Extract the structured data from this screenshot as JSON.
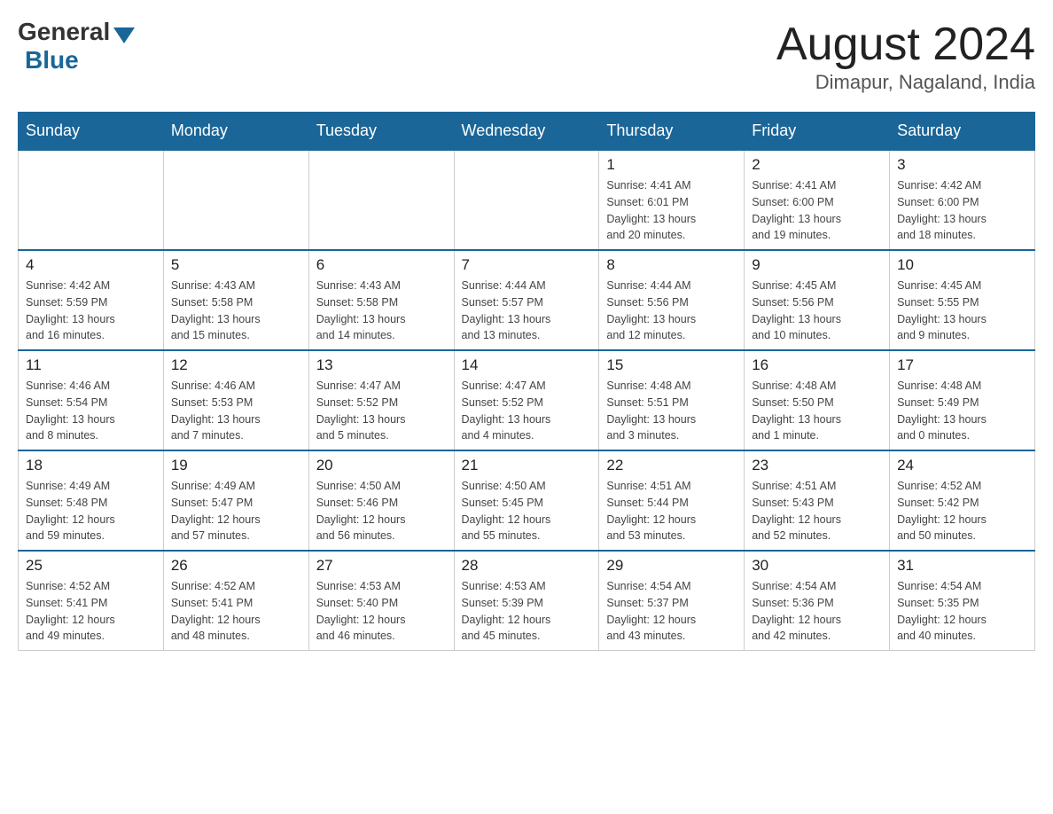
{
  "header": {
    "logo_general": "General",
    "logo_blue": "Blue",
    "month_title": "August 2024",
    "location": "Dimapur, Nagaland, India"
  },
  "weekdays": [
    "Sunday",
    "Monday",
    "Tuesday",
    "Wednesday",
    "Thursday",
    "Friday",
    "Saturday"
  ],
  "weeks": [
    [
      {
        "day": "",
        "info": ""
      },
      {
        "day": "",
        "info": ""
      },
      {
        "day": "",
        "info": ""
      },
      {
        "day": "",
        "info": ""
      },
      {
        "day": "1",
        "info": "Sunrise: 4:41 AM\nSunset: 6:01 PM\nDaylight: 13 hours\nand 20 minutes."
      },
      {
        "day": "2",
        "info": "Sunrise: 4:41 AM\nSunset: 6:00 PM\nDaylight: 13 hours\nand 19 minutes."
      },
      {
        "day": "3",
        "info": "Sunrise: 4:42 AM\nSunset: 6:00 PM\nDaylight: 13 hours\nand 18 minutes."
      }
    ],
    [
      {
        "day": "4",
        "info": "Sunrise: 4:42 AM\nSunset: 5:59 PM\nDaylight: 13 hours\nand 16 minutes."
      },
      {
        "day": "5",
        "info": "Sunrise: 4:43 AM\nSunset: 5:58 PM\nDaylight: 13 hours\nand 15 minutes."
      },
      {
        "day": "6",
        "info": "Sunrise: 4:43 AM\nSunset: 5:58 PM\nDaylight: 13 hours\nand 14 minutes."
      },
      {
        "day": "7",
        "info": "Sunrise: 4:44 AM\nSunset: 5:57 PM\nDaylight: 13 hours\nand 13 minutes."
      },
      {
        "day": "8",
        "info": "Sunrise: 4:44 AM\nSunset: 5:56 PM\nDaylight: 13 hours\nand 12 minutes."
      },
      {
        "day": "9",
        "info": "Sunrise: 4:45 AM\nSunset: 5:56 PM\nDaylight: 13 hours\nand 10 minutes."
      },
      {
        "day": "10",
        "info": "Sunrise: 4:45 AM\nSunset: 5:55 PM\nDaylight: 13 hours\nand 9 minutes."
      }
    ],
    [
      {
        "day": "11",
        "info": "Sunrise: 4:46 AM\nSunset: 5:54 PM\nDaylight: 13 hours\nand 8 minutes."
      },
      {
        "day": "12",
        "info": "Sunrise: 4:46 AM\nSunset: 5:53 PM\nDaylight: 13 hours\nand 7 minutes."
      },
      {
        "day": "13",
        "info": "Sunrise: 4:47 AM\nSunset: 5:52 PM\nDaylight: 13 hours\nand 5 minutes."
      },
      {
        "day": "14",
        "info": "Sunrise: 4:47 AM\nSunset: 5:52 PM\nDaylight: 13 hours\nand 4 minutes."
      },
      {
        "day": "15",
        "info": "Sunrise: 4:48 AM\nSunset: 5:51 PM\nDaylight: 13 hours\nand 3 minutes."
      },
      {
        "day": "16",
        "info": "Sunrise: 4:48 AM\nSunset: 5:50 PM\nDaylight: 13 hours\nand 1 minute."
      },
      {
        "day": "17",
        "info": "Sunrise: 4:48 AM\nSunset: 5:49 PM\nDaylight: 13 hours\nand 0 minutes."
      }
    ],
    [
      {
        "day": "18",
        "info": "Sunrise: 4:49 AM\nSunset: 5:48 PM\nDaylight: 12 hours\nand 59 minutes."
      },
      {
        "day": "19",
        "info": "Sunrise: 4:49 AM\nSunset: 5:47 PM\nDaylight: 12 hours\nand 57 minutes."
      },
      {
        "day": "20",
        "info": "Sunrise: 4:50 AM\nSunset: 5:46 PM\nDaylight: 12 hours\nand 56 minutes."
      },
      {
        "day": "21",
        "info": "Sunrise: 4:50 AM\nSunset: 5:45 PM\nDaylight: 12 hours\nand 55 minutes."
      },
      {
        "day": "22",
        "info": "Sunrise: 4:51 AM\nSunset: 5:44 PM\nDaylight: 12 hours\nand 53 minutes."
      },
      {
        "day": "23",
        "info": "Sunrise: 4:51 AM\nSunset: 5:43 PM\nDaylight: 12 hours\nand 52 minutes."
      },
      {
        "day": "24",
        "info": "Sunrise: 4:52 AM\nSunset: 5:42 PM\nDaylight: 12 hours\nand 50 minutes."
      }
    ],
    [
      {
        "day": "25",
        "info": "Sunrise: 4:52 AM\nSunset: 5:41 PM\nDaylight: 12 hours\nand 49 minutes."
      },
      {
        "day": "26",
        "info": "Sunrise: 4:52 AM\nSunset: 5:41 PM\nDaylight: 12 hours\nand 48 minutes."
      },
      {
        "day": "27",
        "info": "Sunrise: 4:53 AM\nSunset: 5:40 PM\nDaylight: 12 hours\nand 46 minutes."
      },
      {
        "day": "28",
        "info": "Sunrise: 4:53 AM\nSunset: 5:39 PM\nDaylight: 12 hours\nand 45 minutes."
      },
      {
        "day": "29",
        "info": "Sunrise: 4:54 AM\nSunset: 5:37 PM\nDaylight: 12 hours\nand 43 minutes."
      },
      {
        "day": "30",
        "info": "Sunrise: 4:54 AM\nSunset: 5:36 PM\nDaylight: 12 hours\nand 42 minutes."
      },
      {
        "day": "31",
        "info": "Sunrise: 4:54 AM\nSunset: 5:35 PM\nDaylight: 12 hours\nand 40 minutes."
      }
    ]
  ]
}
